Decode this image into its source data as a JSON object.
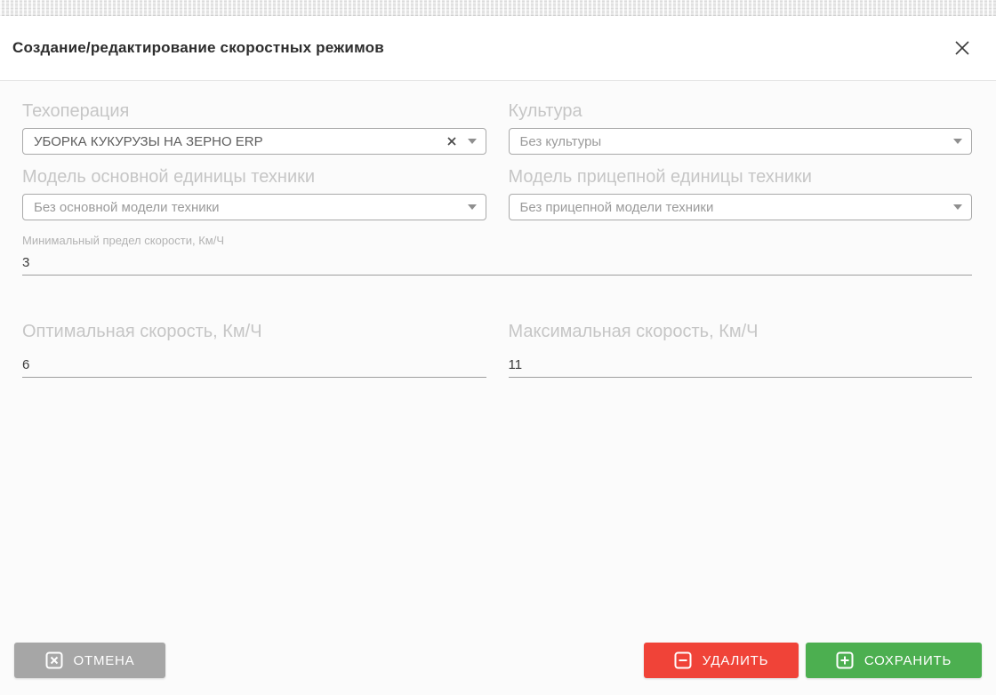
{
  "modal": {
    "title": "Создание/редактирование скоростных режимов",
    "fields": {
      "tech_operation": {
        "label": "Техоперация",
        "value": "УБОРКА КУКУРУЗЫ НА ЗЕРНО ERP"
      },
      "culture": {
        "label": "Культура",
        "placeholder": "Без культуры"
      },
      "main_unit_model": {
        "label": "Модель основной единицы техники",
        "placeholder": "Без основной модели техники"
      },
      "trailer_unit_model": {
        "label": "Модель прицепной единицы техники",
        "placeholder": "Без прицепной модели техники"
      },
      "min_speed": {
        "label": "Минимальный предел скорости, Км/Ч",
        "value": "3"
      },
      "optimal_speed": {
        "label": "Оптимальная скорость, Км/Ч",
        "value": "6"
      },
      "max_speed": {
        "label": "Максимальная скорость, Км/Ч",
        "value": "11"
      }
    },
    "footer": {
      "cancel_label": "ОТМЕНА",
      "delete_label": "УДАЛИТЬ",
      "save_label": "СОХРАНИТЬ"
    },
    "colors": {
      "cancel_bg": "#a6a6a6",
      "delete_bg": "#f04338",
      "save_bg": "#4caf50"
    }
  }
}
